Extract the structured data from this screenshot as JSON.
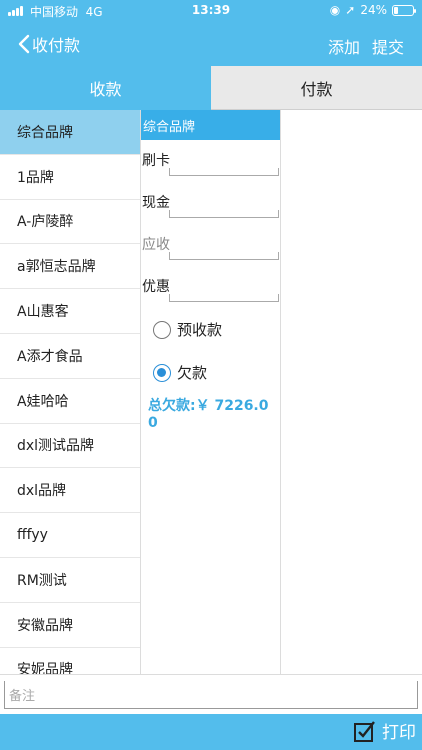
{
  "status_bar": {
    "carrier": "中国移动",
    "network": "4G",
    "time": "13:39",
    "battery": "24%",
    "battery_level": 0.24
  },
  "nav": {
    "back_label": "收付款",
    "add_label": "添加",
    "submit_label": "提交"
  },
  "tabs": [
    {
      "label": "收款",
      "active": true
    },
    {
      "label": "付款",
      "active": false
    }
  ],
  "brands": [
    {
      "label": "综合品牌",
      "selected": true
    },
    {
      "label": "1品牌"
    },
    {
      "label": "A-庐陵醉"
    },
    {
      "label": "a郭恒志品牌"
    },
    {
      "label": "A山惠客"
    },
    {
      "label": "A添才食品"
    },
    {
      "label": "A娃哈哈"
    },
    {
      "label": "dxl测试品牌"
    },
    {
      "label": "dxl品牌"
    },
    {
      "label": "fffyy"
    },
    {
      "label": "RM测试"
    },
    {
      "label": "安徽品牌"
    },
    {
      "label": "安妮品牌"
    }
  ],
  "form": {
    "header": "综合品牌",
    "fields": [
      {
        "label": "刷卡",
        "value": ""
      },
      {
        "label": "现金",
        "value": ""
      },
      {
        "label": "应收",
        "value": "",
        "disabled": true
      },
      {
        "label": "优惠",
        "value": ""
      }
    ],
    "options": [
      {
        "label": "预收款",
        "checked": false
      },
      {
        "label": "欠款",
        "checked": true
      }
    ],
    "total_owed": "总欠款:￥ 7226.00"
  },
  "memo": {
    "placeholder": "备注"
  },
  "bottom": {
    "print_label": "打印"
  },
  "colors": {
    "primary": "#53bdec",
    "selected_row": "#8fd0ee",
    "accent_text": "#3aa9e0"
  }
}
